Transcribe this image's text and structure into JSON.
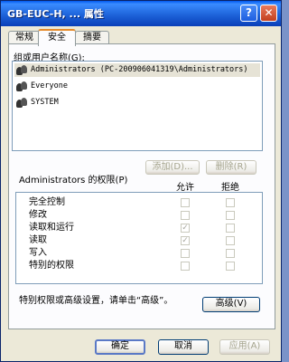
{
  "window": {
    "title": "GB-EUC-H, ... 属性"
  },
  "titlebar_buttons": {
    "help": "?",
    "close": "✕"
  },
  "tabs": [
    {
      "label": "常规"
    },
    {
      "label": "安全"
    },
    {
      "label": "摘要"
    }
  ],
  "group_label": "组或用户名称(G):",
  "users": [
    {
      "name": "Administrators (PC-200906041319\\Administrators)",
      "selected": true,
      "icon": "user-group-icon"
    },
    {
      "name": "Everyone",
      "selected": false,
      "icon": "user-group-icon"
    },
    {
      "name": "SYSTEM",
      "selected": false,
      "icon": "user-group-icon"
    }
  ],
  "add_button": "添加(D)...",
  "remove_button": "删除(R)",
  "perm_title": "Administrators 的权限(P)",
  "allow_header": "允许",
  "deny_header": "拒绝",
  "permissions": [
    {
      "label": "完全控制",
      "allow": false,
      "deny": false
    },
    {
      "label": "修改",
      "allow": false,
      "deny": false
    },
    {
      "label": "读取和运行",
      "allow": true,
      "deny": false
    },
    {
      "label": "读取",
      "allow": true,
      "deny": false
    },
    {
      "label": "写入",
      "allow": false,
      "deny": false
    },
    {
      "label": "特别的权限",
      "allow": false,
      "deny": false
    }
  ],
  "advanced_text": "特别权限或高级设置，请单击“高级”。",
  "advanced_button": "高级(V)",
  "footer": {
    "ok": "确定",
    "cancel": "取消",
    "apply": "应用(A)"
  }
}
